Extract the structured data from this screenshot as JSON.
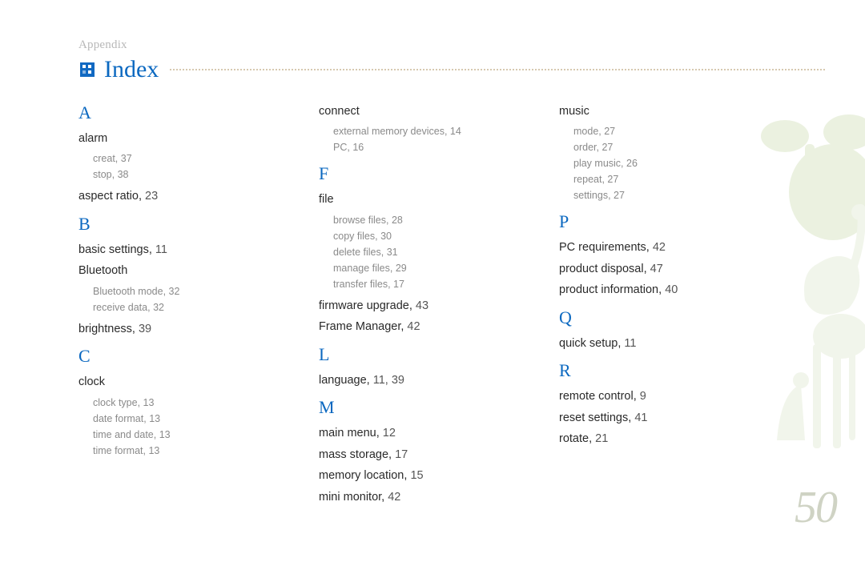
{
  "header": {
    "appendix": "Appendix",
    "title": "Index"
  },
  "page_number": "50",
  "columns": [
    {
      "sections": [
        {
          "letter": "A",
          "entries": [
            {
              "label": "alarm",
              "subs": [
                {
                  "label": "creat",
                  "page": "37"
                },
                {
                  "label": "stop",
                  "page": "38"
                }
              ]
            },
            {
              "label": "aspect ratio",
              "page": "23"
            }
          ]
        },
        {
          "letter": "B",
          "entries": [
            {
              "label": "basic settings",
              "page": "11"
            },
            {
              "label": "Bluetooth",
              "subs": [
                {
                  "label": "Bluetooth mode",
                  "page": "32"
                },
                {
                  "label": "receive data",
                  "page": "32"
                }
              ]
            },
            {
              "label": "brightness",
              "page": "39"
            }
          ]
        },
        {
          "letter": "C",
          "entries": [
            {
              "label": "clock",
              "subs": [
                {
                  "label": "clock type",
                  "page": "13"
                },
                {
                  "label": "date format",
                  "page": "13"
                },
                {
                  "label": "time and date",
                  "page": "13"
                },
                {
                  "label": "time format",
                  "page": "13"
                }
              ]
            }
          ]
        }
      ]
    },
    {
      "sections": [
        {
          "letter": "",
          "entries": [
            {
              "label": "connect",
              "subs": [
                {
                  "label": "external memory devices",
                  "page": "14"
                },
                {
                  "label": "PC",
                  "page": "16"
                }
              ]
            }
          ]
        },
        {
          "letter": "F",
          "entries": [
            {
              "label": "file",
              "subs": [
                {
                  "label": "browse files",
                  "page": "28"
                },
                {
                  "label": "copy files",
                  "page": "30"
                },
                {
                  "label": "delete files",
                  "page": "31"
                },
                {
                  "label": "manage files",
                  "page": "29"
                },
                {
                  "label": "transfer files",
                  "page": "17"
                }
              ]
            },
            {
              "label": "firmware upgrade",
              "page": "43"
            },
            {
              "label": "Frame Manager",
              "page": "42"
            }
          ]
        },
        {
          "letter": "L",
          "entries": [
            {
              "label": "language",
              "page": "11, 39"
            }
          ]
        },
        {
          "letter": "M",
          "entries": [
            {
              "label": "main menu",
              "page": "12"
            },
            {
              "label": "mass storage",
              "page": "17"
            },
            {
              "label": "memory location",
              "page": "15"
            },
            {
              "label": "mini monitor",
              "page": "42"
            }
          ]
        }
      ]
    },
    {
      "sections": [
        {
          "letter": "",
          "entries": [
            {
              "label": "music",
              "subs": [
                {
                  "label": "mode",
                  "page": "27"
                },
                {
                  "label": "order",
                  "page": "27"
                },
                {
                  "label": "play music",
                  "page": "26"
                },
                {
                  "label": "repeat",
                  "page": "27"
                },
                {
                  "label": "settings",
                  "page": "27"
                }
              ]
            }
          ]
        },
        {
          "letter": "P",
          "entries": [
            {
              "label": "PC requirements",
              "page": "42"
            },
            {
              "label": "product disposal",
              "page": "47"
            },
            {
              "label": "product information",
              "page": "40"
            }
          ]
        },
        {
          "letter": "Q",
          "entries": [
            {
              "label": "quick setup",
              "page": "11"
            }
          ]
        },
        {
          "letter": "R",
          "entries": [
            {
              "label": "remote control",
              "page": "9"
            },
            {
              "label": "reset settings",
              "page": "41"
            },
            {
              "label": "rotate",
              "page": "21"
            }
          ]
        }
      ]
    }
  ]
}
